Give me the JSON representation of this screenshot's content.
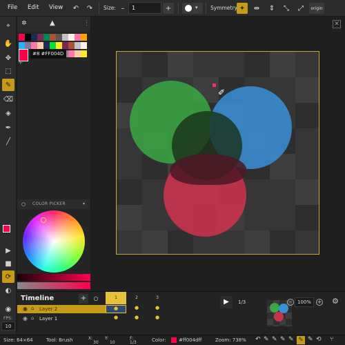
{
  "menu": {
    "file": "File",
    "edit": "Edit",
    "view": "View"
  },
  "toolbar": {
    "size_label": "Size:",
    "size_value": "1",
    "symmetry_label": "Symmetry:",
    "origin_label": "origin"
  },
  "palette": {
    "tooltip": "#8 #FF004D"
  },
  "color_picker": {
    "title": "COLOR PICKER"
  },
  "timeline": {
    "title": "Timeline",
    "frames": [
      "1",
      "2",
      "3"
    ],
    "layers": [
      {
        "name": "Layer 2",
        "active": true
      },
      {
        "name": "Layer 1",
        "active": false
      }
    ],
    "fps_label": "FPS:",
    "fps_value": "10",
    "frame_counter": "1/3",
    "zoom": "100%"
  },
  "status": {
    "size": "Size: 64×64",
    "tool": "Tool: Brush",
    "x_label": "X:",
    "x_value": "30",
    "y_label": "Y:",
    "y_value": "10",
    "f_label": "F:",
    "f_value": "1/3",
    "color_label": "Color:",
    "color_hex": "#ff004dff",
    "zoom": "Zoom: 738%"
  },
  "colors": {
    "accent": "#c79a1a",
    "primary": "#FF004D",
    "secondary": "#3a3af0",
    "green": "#3aa844",
    "blue": "#3a8fd9",
    "red": "#c8334c"
  }
}
